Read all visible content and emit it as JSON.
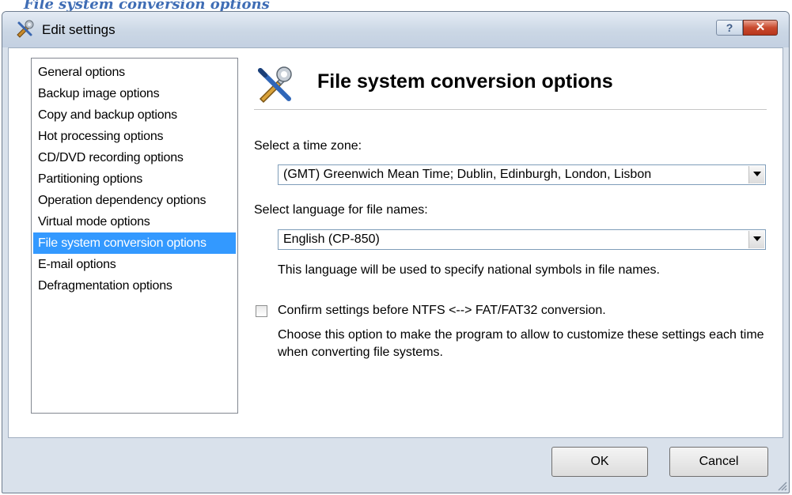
{
  "header": {
    "text": "File system conversion options"
  },
  "window": {
    "title": "Edit settings",
    "help_label": "?",
    "close_label": "✕"
  },
  "nav": {
    "items": [
      {
        "label": "General options",
        "selected": false
      },
      {
        "label": "Backup image options",
        "selected": false
      },
      {
        "label": "Copy and backup options",
        "selected": false
      },
      {
        "label": "Hot processing options",
        "selected": false
      },
      {
        "label": "CD/DVD recording options",
        "selected": false
      },
      {
        "label": "Partitioning options",
        "selected": false
      },
      {
        "label": "Operation dependency options",
        "selected": false
      },
      {
        "label": "Virtual mode options",
        "selected": false
      },
      {
        "label": "File system conversion options",
        "selected": true
      },
      {
        "label": "E-mail options",
        "selected": false
      },
      {
        "label": "Defragmentation options",
        "selected": false
      }
    ]
  },
  "content": {
    "title": "File system conversion options",
    "timezone_label": "Select a time zone:",
    "timezone_value": "(GMT) Greenwich Mean Time; Dublin, Edinburgh, London, Lisbon",
    "language_label": "Select language for file names:",
    "language_value": "English (CP-850)",
    "language_hint": "This language will be used to specify national symbols in file names.",
    "confirm_label": "Confirm settings before NTFS <--> FAT/FAT32 conversion.",
    "confirm_checked": false,
    "confirm_description": "Choose this option to make the program to allow to customize these settings each time when converting file systems."
  },
  "buttons": {
    "ok": "OK",
    "cancel": "Cancel"
  },
  "icons": {
    "app": "wrench-screwdriver-icon",
    "content": "tools-icon",
    "dropdown": "chevron-down-icon"
  },
  "colors": {
    "selection": "#3399ff",
    "header_text": "#3f6db5",
    "close_button": "#c94a2e"
  }
}
